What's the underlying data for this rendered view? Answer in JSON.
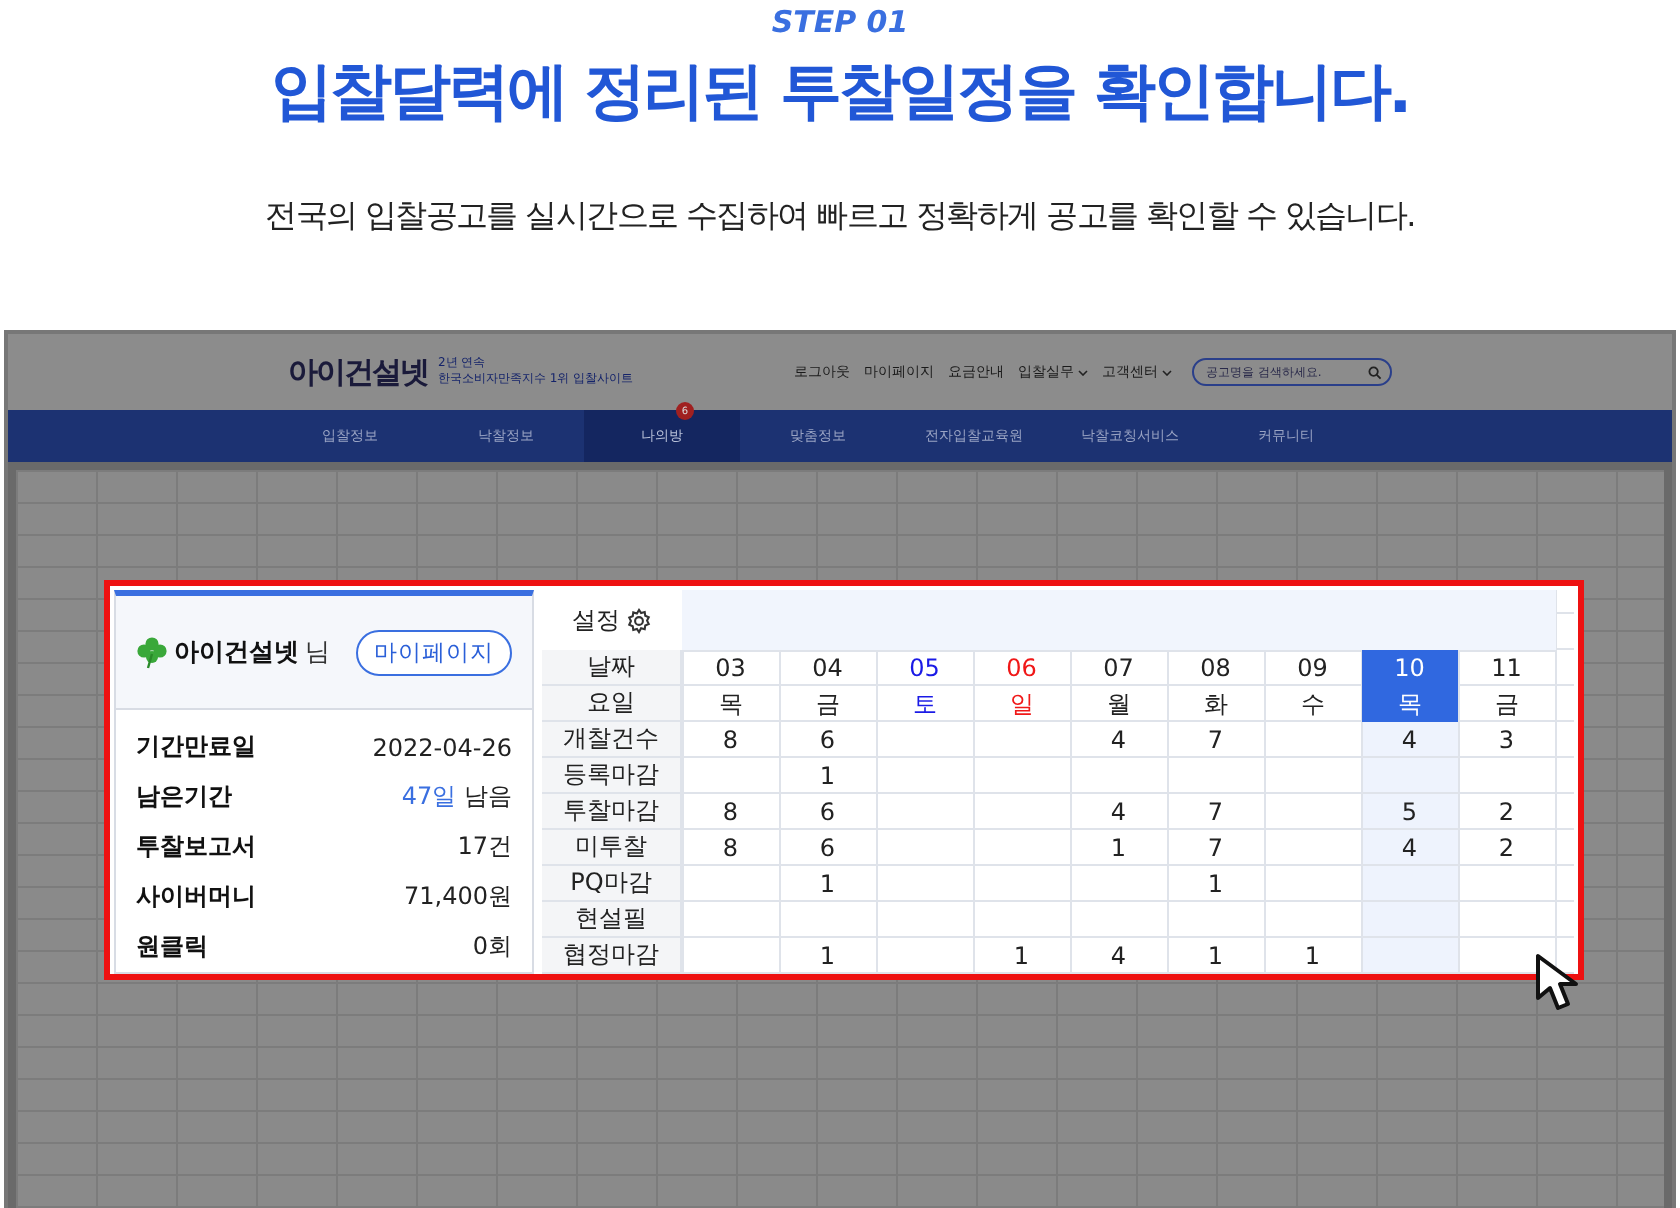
{
  "step": "STEP 01",
  "headline": "입찰달력에 정리된 투찰일정을 확인합니다.",
  "subtitle": "전국의 입찰공고를 실시간으로 수집하여 빠르고 정확하게 공고를 확인할 수 있습니다.",
  "site": {
    "logo": "아이건설넷",
    "tagline_top": "2년 연속",
    "tagline": "한국소비자만족지수 1위 입찰사이트",
    "header_links": [
      {
        "label": "로그아웃",
        "dropdown": false
      },
      {
        "label": "마이페이지",
        "dropdown": false
      },
      {
        "label": "요금안내",
        "dropdown": false
      },
      {
        "label": "입찰실무",
        "dropdown": true
      },
      {
        "label": "고객센터",
        "dropdown": true
      }
    ],
    "search": {
      "placeholder": "공고명을 검색하세요."
    },
    "nav": [
      {
        "label": "입찰정보",
        "selected": false
      },
      {
        "label": "낙찰정보",
        "selected": false
      },
      {
        "label": "나의방",
        "selected": true,
        "badge": "6"
      },
      {
        "label": "맞춤정보",
        "selected": false
      },
      {
        "label": "전자입찰교육원",
        "selected": false
      },
      {
        "label": "낙찰코칭서비스",
        "selected": false
      },
      {
        "label": "커뮤니티",
        "selected": false
      }
    ]
  },
  "user_card": {
    "name": "아이건설넷",
    "suffix": "님",
    "button": "마이페이지",
    "rows": [
      {
        "label": "기간만료일",
        "value": "2022-04-26"
      },
      {
        "label": "남은기간",
        "accent": "47일",
        "value": "남음"
      },
      {
        "label": "투찰보고서",
        "value": "17건"
      },
      {
        "label": "사이버머니",
        "value": "71,400원"
      },
      {
        "label": "원클릭",
        "value": "0회"
      }
    ]
  },
  "calendar": {
    "settings": "설정",
    "date_label": "날짜",
    "weekday_label": "요일",
    "days": [
      {
        "date": "03",
        "weekday": "목",
        "kind": "weekday",
        "selected": false
      },
      {
        "date": "04",
        "weekday": "금",
        "kind": "weekday",
        "selected": false
      },
      {
        "date": "05",
        "weekday": "토",
        "kind": "saturday",
        "selected": false
      },
      {
        "date": "06",
        "weekday": "일",
        "kind": "sunday",
        "selected": false
      },
      {
        "date": "07",
        "weekday": "월",
        "kind": "weekday",
        "selected": false
      },
      {
        "date": "08",
        "weekday": "화",
        "kind": "weekday",
        "selected": false
      },
      {
        "date": "09",
        "weekday": "수",
        "kind": "weekday",
        "selected": false
      },
      {
        "date": "10",
        "weekday": "목",
        "kind": "weekday",
        "selected": true
      },
      {
        "date": "11",
        "weekday": "금",
        "kind": "weekday",
        "selected": false
      }
    ],
    "rows": [
      {
        "label": "개찰건수",
        "values": {
          "03": "8",
          "04": "6",
          "07": "4",
          "08": "7",
          "10": "4",
          "11": "3"
        }
      },
      {
        "label": "등록마감",
        "values": {
          "04": "1"
        }
      },
      {
        "label": "투찰마감",
        "values": {
          "03": "8",
          "04": "6",
          "07": "4",
          "08": "7",
          "10": "5",
          "11": "2"
        }
      },
      {
        "label": "미투찰",
        "values": {
          "03": "8",
          "04": "6",
          "07": "1",
          "08": "7",
          "10": "4",
          "11": "2"
        }
      },
      {
        "label": "PQ마감",
        "values": {
          "04": "1",
          "08": "1"
        }
      },
      {
        "label": "현설필"
      },
      {
        "label": "협정마감",
        "values": {
          "04": "1",
          "06": "1",
          "07": "4",
          "08": "1",
          "09": "1"
        }
      }
    ]
  }
}
